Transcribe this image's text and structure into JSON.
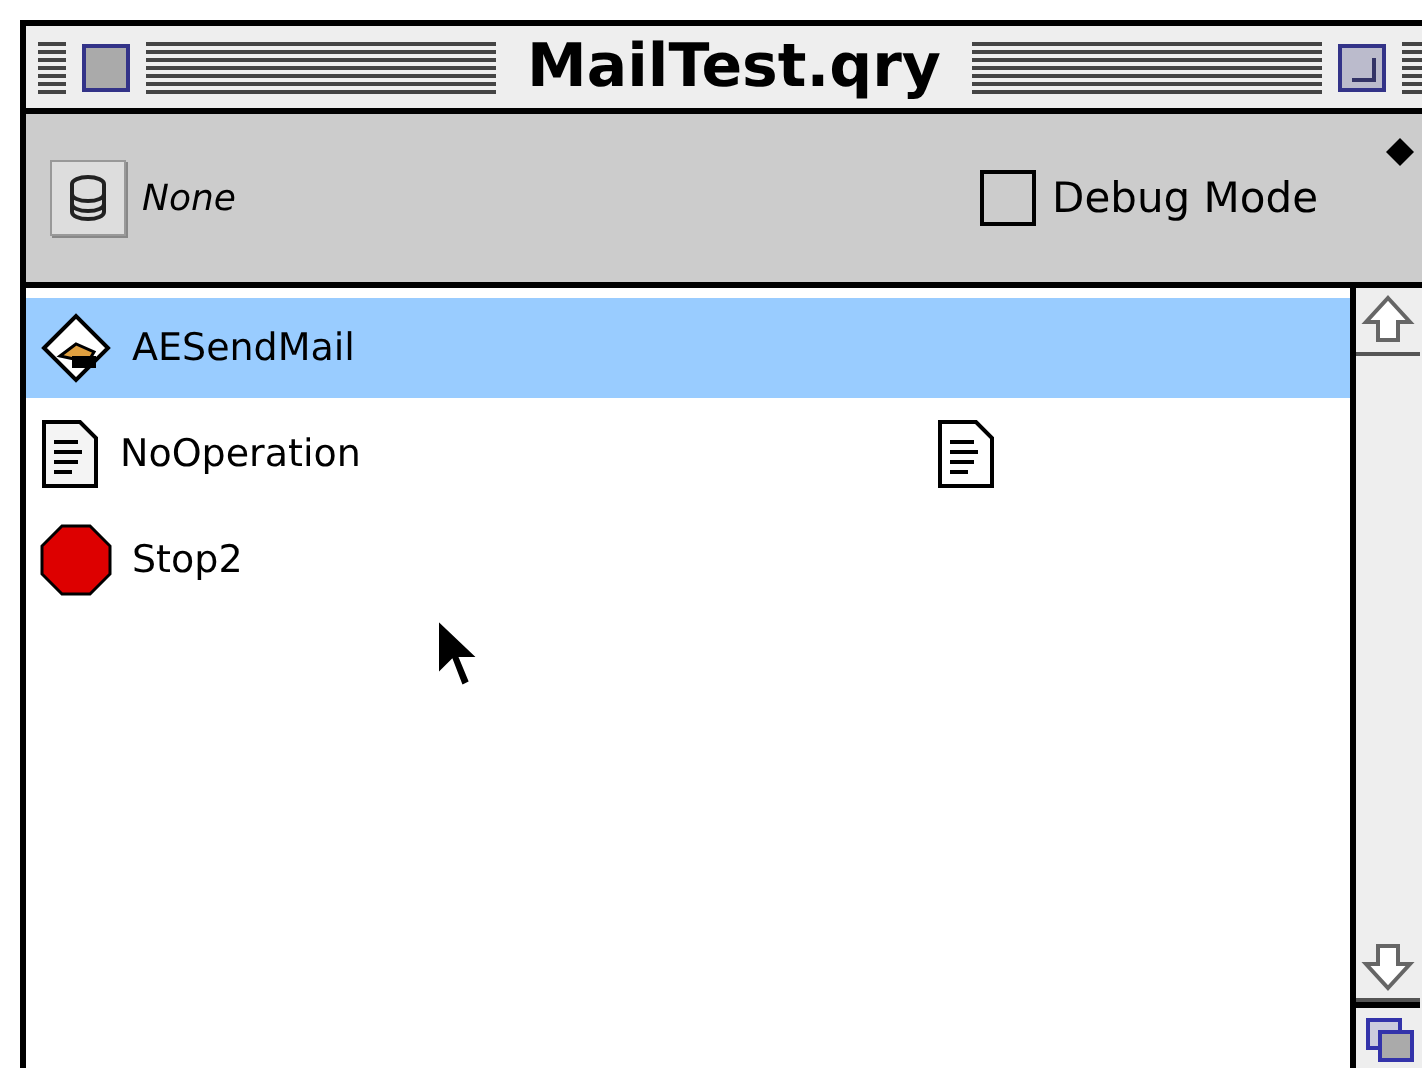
{
  "window": {
    "title": "MailTest.qry"
  },
  "toolbar": {
    "database": "None",
    "debug_mode": {
      "label": "Debug Mode",
      "checked": false
    }
  },
  "items": [
    {
      "name": "AESendMail",
      "kind": "send",
      "selected": true,
      "detail_icon": false
    },
    {
      "name": "NoOperation",
      "kind": "document",
      "selected": false,
      "detail_icon": true
    },
    {
      "name": "Stop2",
      "kind": "stop",
      "selected": false,
      "detail_icon": false
    }
  ]
}
